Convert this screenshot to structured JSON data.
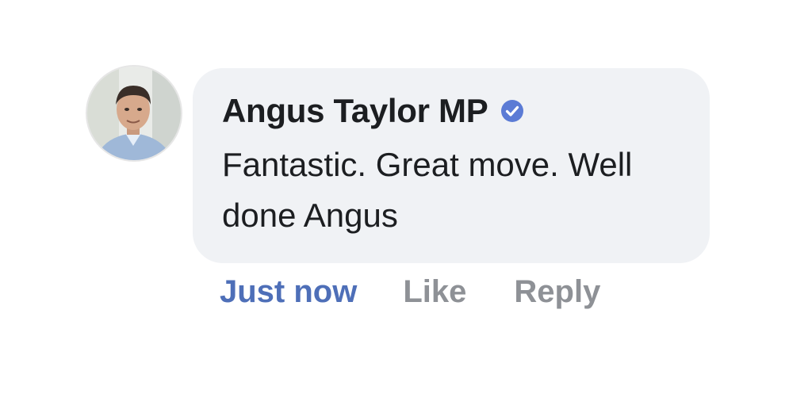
{
  "comment": {
    "author": "Angus Taylor MP",
    "verified_icon": "verified-badge-icon",
    "text": "Fantastic. Great move. Well done Angus",
    "timestamp": "Just now",
    "like_label": "Like",
    "reply_label": "Reply"
  },
  "colors": {
    "bubble_background": "#f0f2f5",
    "author_text": "#1c1e21",
    "timestamp": "#4e6fb8",
    "action_text": "#8e9196",
    "verified_badge": "#5b7bd5"
  }
}
